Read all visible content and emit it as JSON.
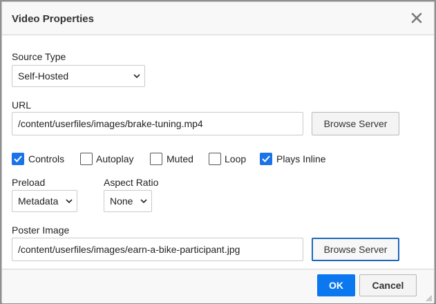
{
  "dialog": {
    "title": "Video Properties",
    "close_icon": "close-icon"
  },
  "source_type": {
    "label": "Source Type",
    "value": "Self-Hosted"
  },
  "url": {
    "label": "URL",
    "value": "/content/userfiles/images/brake-tuning.mp4",
    "browse_label": "Browse Server"
  },
  "options": [
    {
      "label": "Controls",
      "checked": true
    },
    {
      "label": "Autoplay",
      "checked": false
    },
    {
      "label": "Muted",
      "checked": false
    },
    {
      "label": "Loop",
      "checked": false
    },
    {
      "label": "Plays Inline",
      "checked": true
    }
  ],
  "preload": {
    "label": "Preload",
    "value": "Metadata"
  },
  "aspect_ratio": {
    "label": "Aspect Ratio",
    "value": "None"
  },
  "poster": {
    "label": "Poster Image",
    "value": "/content/userfiles/images/earn-a-bike-participant.jpg",
    "browse_label": "Browse Server"
  },
  "footer": {
    "ok_label": "OK",
    "cancel_label": "Cancel"
  },
  "colors": {
    "primary": "#0b78f0",
    "checkbox_checked": "#1a73e8",
    "focus_border": "#1d66b8"
  }
}
